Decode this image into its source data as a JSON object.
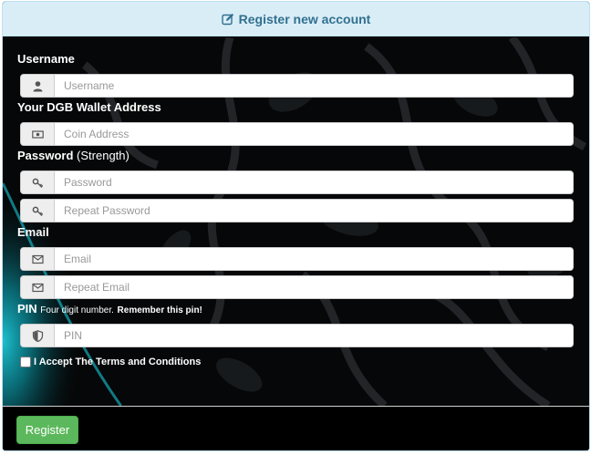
{
  "header": {
    "title": "Register new account",
    "icon": "edit-icon"
  },
  "form": {
    "username": {
      "label": "Username",
      "placeholder": "Username",
      "icon": "user-icon"
    },
    "wallet": {
      "label": "Your DGB Wallet Address",
      "placeholder": "Coin Address",
      "icon": "money-icon"
    },
    "password": {
      "label": "Password",
      "strength_label": "(Strength)",
      "placeholder": "Password",
      "repeat_placeholder": "Repeat Password",
      "icon": "key-icon"
    },
    "email": {
      "label": "Email",
      "placeholder": "Email",
      "repeat_placeholder": "Repeat Email",
      "icon": "envelope-icon"
    },
    "pin": {
      "label": "PIN",
      "hint": "Four digit number.",
      "hint_strong": "Remember this pin!",
      "placeholder": "PIN",
      "icon": "shield-icon"
    },
    "terms": {
      "label": "I Accept The Terms and Conditions",
      "checked": false
    }
  },
  "footer": {
    "register_label": "Register",
    "button_color": "#5cb85c"
  },
  "colors": {
    "heading_bg": "#d9edf7",
    "heading_text": "#31708f",
    "accent_teal": "#0fb6c8"
  }
}
